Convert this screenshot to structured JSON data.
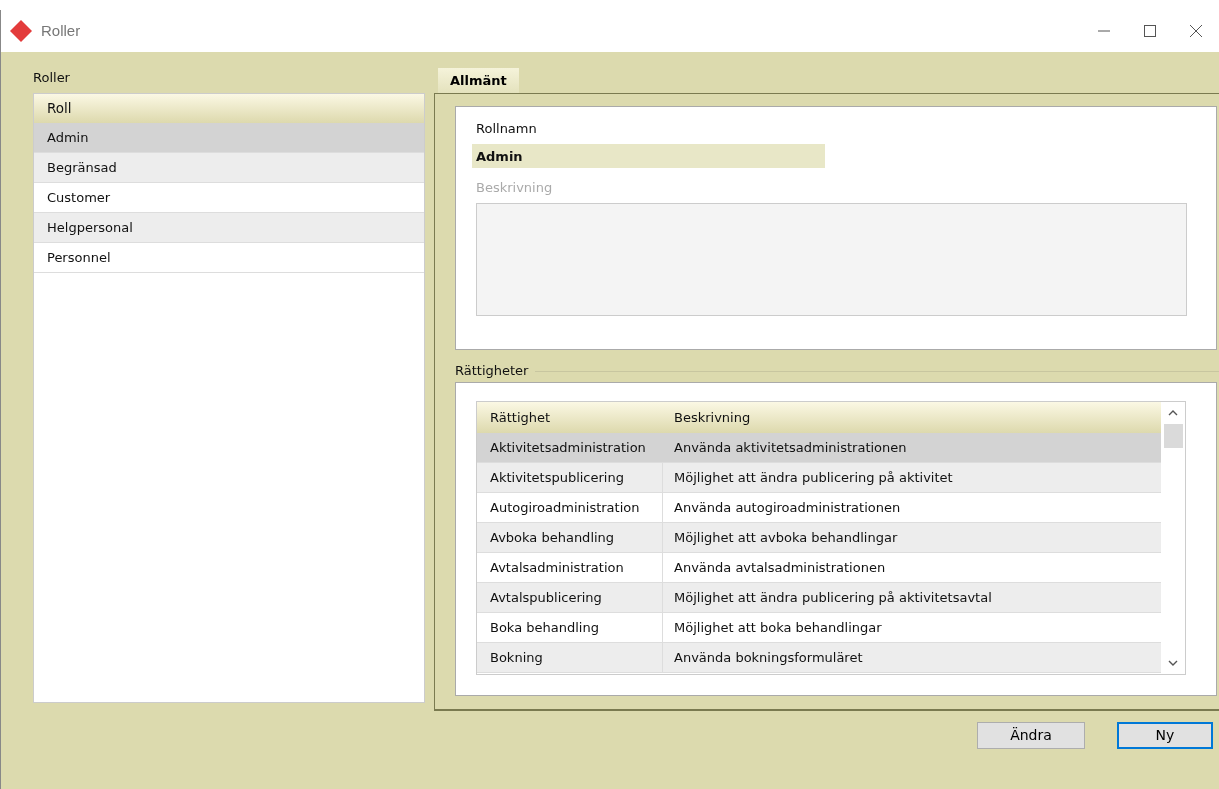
{
  "window": {
    "title": "Roller"
  },
  "roles_panel": {
    "label": "Roller",
    "column": "Roll",
    "rows": [
      {
        "name": "Admin",
        "selected": true
      },
      {
        "name": "Begränsad",
        "selected": false
      },
      {
        "name": "Customer",
        "selected": false
      },
      {
        "name": "Helgpersonal",
        "selected": false
      },
      {
        "name": "Personnel",
        "selected": false
      }
    ]
  },
  "tabs": [
    {
      "label": "Allmänt",
      "selected": true
    }
  ],
  "general": {
    "name_label": "Rollnamn",
    "name_value": "Admin",
    "description_label": "Beskrivning"
  },
  "rights": {
    "label": "Rättigheter",
    "columns": [
      "Rättighet",
      "Beskrivning"
    ],
    "rows": [
      {
        "right": "Aktivitetsadministration",
        "description": "Använda aktivitetsadministrationen",
        "selected": true
      },
      {
        "right": "Aktivitetspublicering",
        "description": "Möjlighet att ändra publicering på aktivitet",
        "selected": false
      },
      {
        "right": "Autogiroadministration",
        "description": "Använda autogiroadministrationen",
        "selected": false
      },
      {
        "right": "Avboka behandling",
        "description": "Möjlighet att avboka behandlingar",
        "selected": false
      },
      {
        "right": "Avtalsadministration",
        "description": "Använda avtalsadministrationen",
        "selected": false
      },
      {
        "right": "Avtalspublicering",
        "description": "Möjlighet att ändra publicering på aktivitetsavtal",
        "selected": false
      },
      {
        "right": "Boka behandling",
        "description": "Möjlighet att boka behandlingar",
        "selected": false
      },
      {
        "right": "Bokning",
        "description": "Använda bokningsformuläret",
        "selected": false
      }
    ]
  },
  "buttons": [
    {
      "label": "Ändra",
      "focused": false
    },
    {
      "label": "Ny",
      "focused": true
    }
  ]
}
